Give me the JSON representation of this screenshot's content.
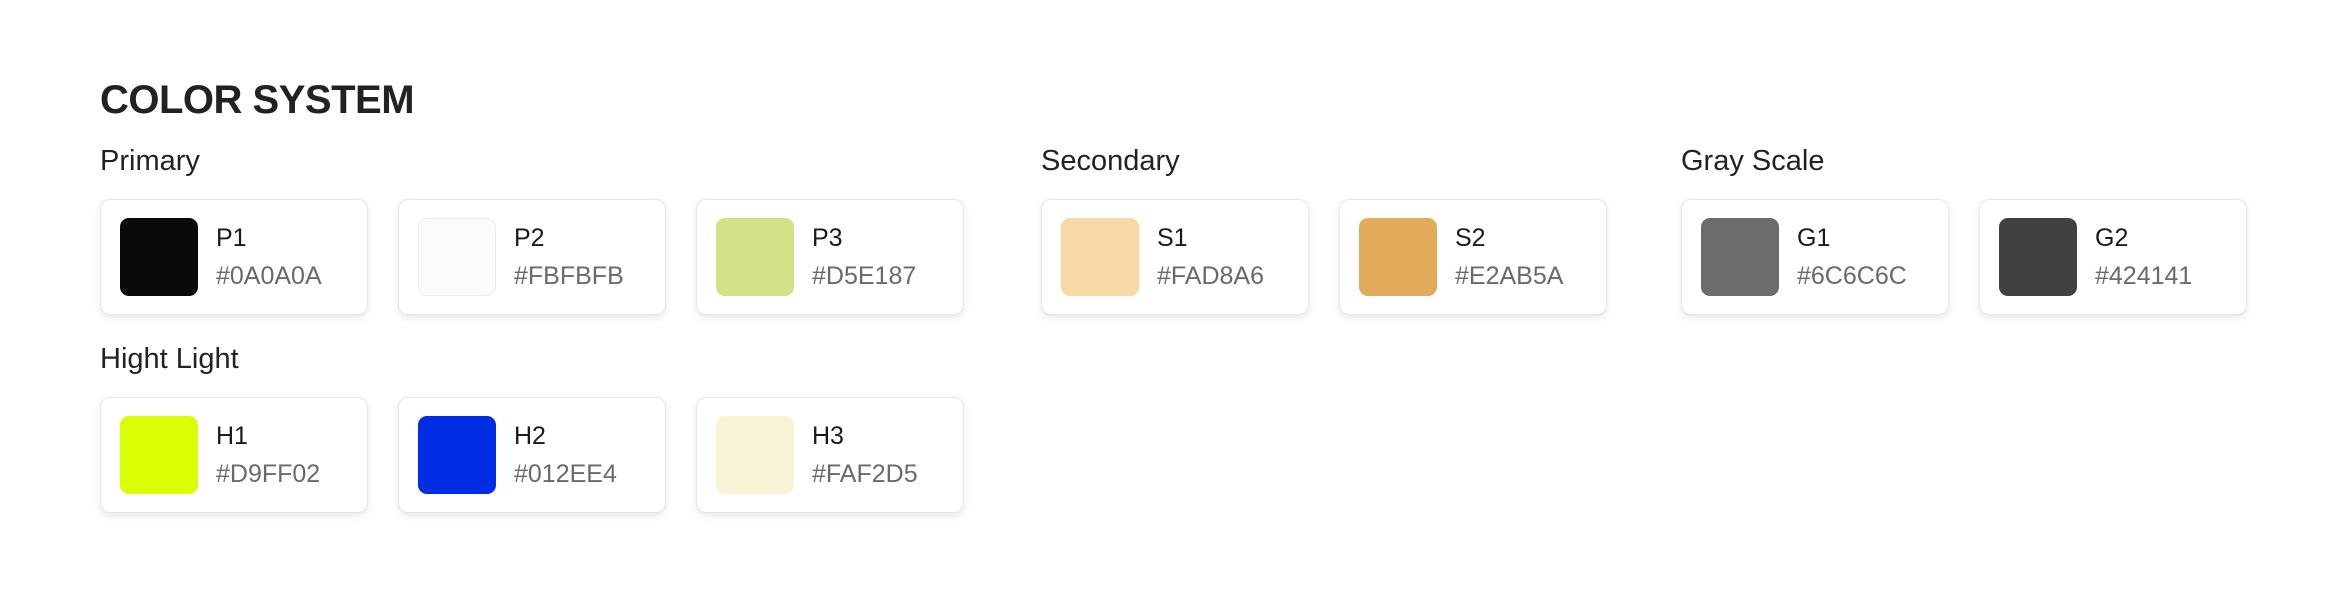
{
  "title": "COLOR SYSTEM",
  "groups": {
    "primary": {
      "label": "Primary",
      "swatches": [
        {
          "code": "P1",
          "hex": "#0A0A0A"
        },
        {
          "code": "P2",
          "hex": "#FBFBFB"
        },
        {
          "code": "P3",
          "hex": "#D5E187"
        }
      ]
    },
    "secondary": {
      "label": "Secondary",
      "swatches": [
        {
          "code": "S1",
          "hex": "#FAD8A6"
        },
        {
          "code": "S2",
          "hex": "#E2AB5A"
        }
      ]
    },
    "grayscale": {
      "label": "Gray Scale",
      "swatches": [
        {
          "code": "G1",
          "hex": "#6C6C6C"
        },
        {
          "code": "G2",
          "hex": "#424141"
        }
      ]
    },
    "highlight": {
      "label": "Hight Light",
      "swatches": [
        {
          "code": "H1",
          "hex": "#D9FF02"
        },
        {
          "code": "H2",
          "hex": "#012EE4"
        },
        {
          "code": "H3",
          "hex": "#FAF2D5"
        }
      ]
    }
  }
}
